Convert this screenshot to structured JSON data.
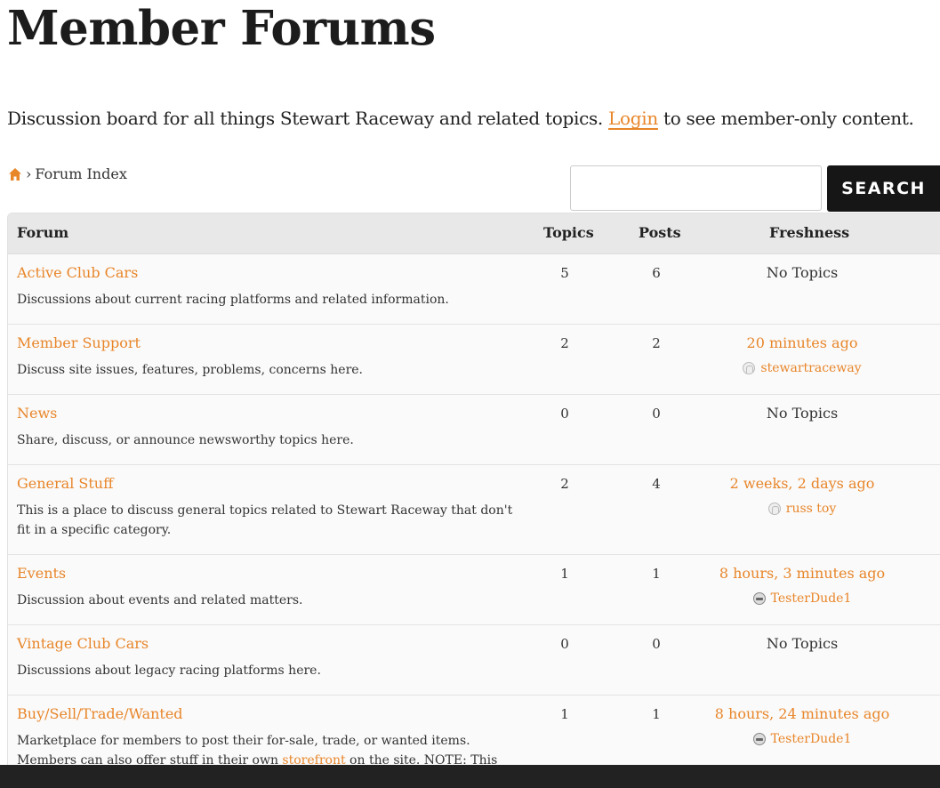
{
  "page": {
    "title": "Member Forums",
    "intro_before": "Discussion board for all things Stewart Raceway and related topics. ",
    "login_link": "Login",
    "intro_after": " to see member-only content."
  },
  "breadcrumb": {
    "separator": "›",
    "current": "Forum Index",
    "home_icon": "home-icon"
  },
  "search": {
    "placeholder": "",
    "button_label": "SEARCH"
  },
  "table": {
    "headers": {
      "forum": "Forum",
      "topics": "Topics",
      "posts": "Posts",
      "freshness": "Freshness"
    },
    "rows": [
      {
        "name": "Active Club Cars",
        "description": "Discussions about current racing platforms and related information.",
        "topics": "5",
        "posts": "6",
        "freshness": "No Topics",
        "author": ""
      },
      {
        "name": "Member Support",
        "description": "Discuss site issues, features, problems, concerns here.",
        "topics": "2",
        "posts": "2",
        "freshness": "20 minutes ago",
        "author": "stewartraceway"
      },
      {
        "name": "News",
        "description": "Share, discuss, or announce newsworthy topics here.",
        "topics": "0",
        "posts": "0",
        "freshness": "No Topics",
        "author": ""
      },
      {
        "name": "General Stuff",
        "description": "This is a place to discuss general topics related to Stewart Raceway that don't fit in a specific category.",
        "topics": "2",
        "posts": "4",
        "freshness": "2 weeks, 2 days ago",
        "author": "russ toy"
      },
      {
        "name": "Events",
        "description": "Discussion about events and related matters.",
        "topics": "1",
        "posts": "1",
        "freshness": "8 hours, 3 minutes ago",
        "author": "TesterDude1"
      },
      {
        "name": "Vintage Club Cars",
        "description": "Discussions about legacy racing platforms here.",
        "topics": "0",
        "posts": "0",
        "freshness": "No Topics",
        "author": ""
      },
      {
        "name": "Buy/Sell/Trade/Wanted",
        "description_before": "Marketplace for members to post their for-sale, trade, or wanted items. Members can also offer stuff in their own ",
        "description_link": "storefront",
        "description_after": " on the site. NOTE: This forum is",
        "topics": "1",
        "posts": "1",
        "freshness": "8 hours, 24 minutes ago",
        "author": "TesterDude1"
      }
    ]
  },
  "colors": {
    "accent": "#e8862a",
    "button_bg": "#161616",
    "header_bg": "#e8e8e8",
    "footer_bg": "#222222"
  }
}
